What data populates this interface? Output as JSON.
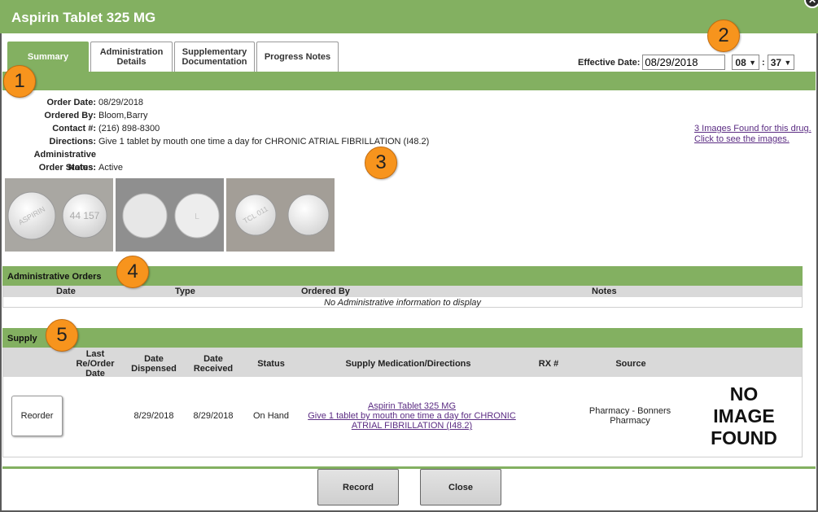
{
  "window": {
    "title": "Aspirin Tablet 325 MG"
  },
  "tabs": [
    {
      "label": "Summary"
    },
    {
      "label": "Administration Details"
    },
    {
      "label": "Supplementary Documentation"
    },
    {
      "label": "Progress Notes"
    }
  ],
  "effective": {
    "label": "Effective Date:",
    "date": "08/29/2018",
    "hour": "08",
    "separator": ":",
    "minute": "37",
    "chevron": "▼"
  },
  "badges": [
    "1",
    "2",
    "3",
    "4",
    "5"
  ],
  "details": [
    {
      "label": "Order Date:",
      "value": "08/29/2018"
    },
    {
      "label": "Ordered By:",
      "value": "Bloom,Barry"
    },
    {
      "label": "Contact #:",
      "value": "(216) 898-8300"
    },
    {
      "label": "Directions:",
      "value": "Give 1 tablet by mouth one time a day for CHRONIC ATRIAL FIBRILLATION (I48.2)"
    },
    {
      "label": "Administrative Notes:",
      "value": ""
    },
    {
      "label": "Order Status:",
      "value": "Active"
    }
  ],
  "images_link": {
    "line1": "3 Images Found for this drug.",
    "line2": "Click to see the images."
  },
  "pill_imprints": [
    "44 157",
    "ASPIRIN",
    "L",
    "TCL 011"
  ],
  "admin_orders": {
    "title": "Administrative Orders",
    "columns": [
      "Date",
      "Type",
      "Ordered By",
      "Notes"
    ],
    "empty_message": "No Administrative information to display"
  },
  "supply": {
    "title": "Supply",
    "columns": [
      "Last Re/Order Date",
      "Date Dispensed",
      "Date Received",
      "Status",
      "Supply Medication/Directions",
      "RX #",
      "Source"
    ],
    "row": {
      "reorder_label": "Reorder",
      "last_reorder": "",
      "date_dispensed": "8/29/2018",
      "date_received": "8/29/2018",
      "status": "On Hand",
      "medication": "Aspirin Tablet 325 MG",
      "directions": "Give 1 tablet by mouth one time a day for CHRONIC ATRIAL FIBRILLATION (I48.2)",
      "rx": "",
      "source": "Pharmacy - Bonners Pharmacy",
      "no_image": "NO IMAGE FOUND"
    }
  },
  "footer": {
    "record_label": "Record",
    "close_label": "Close"
  },
  "icons": {
    "close": "close-icon",
    "dropdown": "chevron-down-icon"
  },
  "colors": {
    "accent": "#83b061",
    "badge": "#f7941d",
    "link": "#5b2c83"
  }
}
